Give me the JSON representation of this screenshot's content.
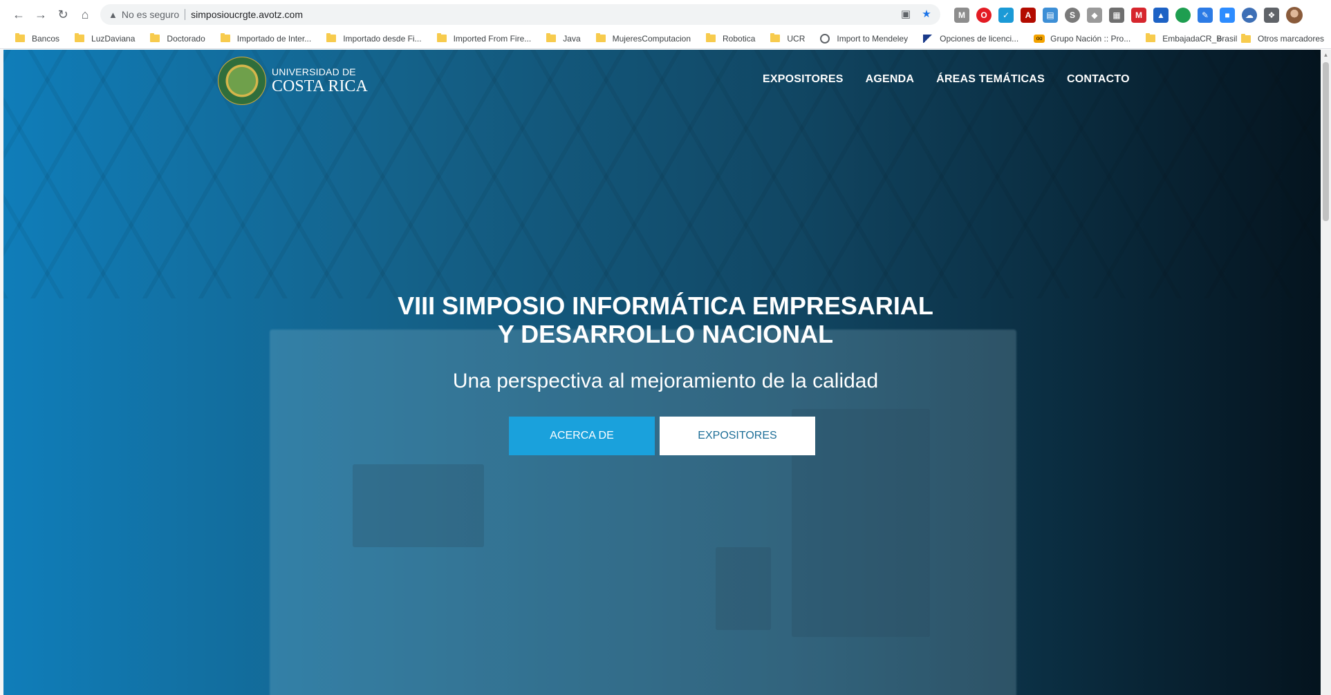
{
  "browser": {
    "url_warning": "No es seguro",
    "url": "simposioucrgte.avotz.com",
    "bookmarks": [
      "Bancos",
      "LuzDaviana",
      "Doctorado",
      "Importado de Inter...",
      "Importado desde Fi...",
      "Imported From Fire...",
      "Java",
      "MujeresComputacion",
      "Robotica",
      "UCR",
      "Import to Mendeley",
      "Opciones de licenci...",
      "Grupo Nación :: Pro...",
      "EmbajadaCR_Brasil"
    ],
    "more_bookmarks": "»",
    "other_bookmarks": "Otros marcadores"
  },
  "site": {
    "logo_top": "UNIVERSIDAD DE",
    "logo_bottom": "COSTA RICA",
    "nav": [
      "EXPOSITORES",
      "AGENDA",
      "ÁREAS TEMÁTICAS",
      "CONTACTO"
    ],
    "hero_line1": "VIII SIMPOSIO INFORMÁTICA EMPRESARIAL",
    "hero_line2": "Y DESARROLLO NACIONAL",
    "hero_subtitle": "Una perspectiva al mejoramiento de la calidad",
    "btn_primary": "ACERCA DE",
    "btn_secondary": "EXPOSITORES"
  },
  "colors": {
    "accent": "#1aa1dc",
    "star": "#1a73e8"
  },
  "icons": {
    "back": "arrow-left-icon",
    "forward": "arrow-right-icon",
    "reload": "reload-icon",
    "home": "home-icon",
    "warning": "warning-icon",
    "bookmark_star": "star-icon",
    "extensions": "puzzle-icon"
  }
}
